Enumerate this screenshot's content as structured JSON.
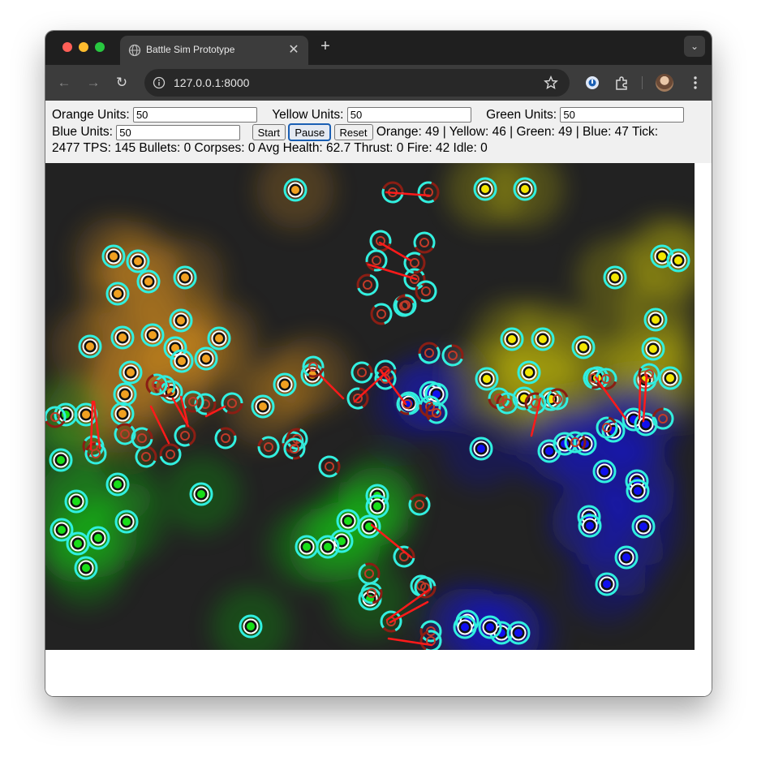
{
  "browser": {
    "tab_title": "Battle Sim Prototype",
    "url": "127.0.0.1:8000",
    "favicon": "globe-icon"
  },
  "controls": {
    "orange_label": "Orange Units:",
    "orange_value": "50",
    "yellow_label": "Yellow Units:",
    "yellow_value": "50",
    "green_label": "Green Units:",
    "green_value": "50",
    "blue_label": "Blue Units:",
    "blue_value": "50",
    "start_label": "Start",
    "pause_label": "Pause",
    "reset_label": "Reset"
  },
  "stats": {
    "line1": "Orange: 49 | Yellow: 46 | Green: 49 | Blue: 47 Tick:",
    "line2": "2477 TPS: 145 Bullets: 0 Corpses: 0 Avg Health: 62.7 Thrust: 0 Fire: 42 Idle: 0"
  },
  "colors": {
    "orange": "#f0a020",
    "yellow": "#f2e600",
    "green": "#18dd18",
    "blue": "#1010ee",
    "ring": "#30f0e0",
    "laser": "#ff1a1a",
    "canvas_bg": "#222222"
  },
  "simulation": {
    "units": {
      "orange": [
        [
          308,
          33
        ],
        [
          84,
          115
        ],
        [
          114,
          121
        ],
        [
          127,
          146
        ],
        [
          89,
          161
        ],
        [
          172,
          141
        ],
        [
          167,
          194
        ],
        [
          95,
          215
        ],
        [
          55,
          226
        ],
        [
          132,
          212
        ],
        [
          214,
          216
        ],
        [
          160,
          228
        ],
        [
          105,
          258
        ],
        [
          98,
          285
        ],
        [
          155,
          282
        ],
        [
          198,
          241
        ],
        [
          168,
          244
        ],
        [
          95,
          309
        ],
        [
          50,
          310
        ],
        [
          295,
          273
        ],
        [
          268,
          300
        ],
        [
          329,
          261
        ]
      ],
      "yellow": [
        [
          542,
          32
        ],
        [
          591,
          32
        ],
        [
          702,
          141
        ],
        [
          760,
          115
        ],
        [
          780,
          120
        ],
        [
          575,
          217
        ],
        [
          613,
          217
        ],
        [
          752,
          193
        ],
        [
          749,
          229
        ],
        [
          663,
          227
        ],
        [
          544,
          266
        ],
        [
          596,
          258
        ],
        [
          623,
          291
        ],
        [
          680,
          265
        ],
        [
          739,
          267
        ],
        [
          770,
          265
        ],
        [
          590,
          290
        ]
      ],
      "green": [
        [
          19,
          366
        ],
        [
          89,
          396
        ],
        [
          40,
          469
        ],
        [
          20,
          452
        ],
        [
          100,
          442
        ],
        [
          38,
          417
        ],
        [
          65,
          462
        ],
        [
          50,
          499
        ],
        [
          192,
          408
        ],
        [
          409,
          410
        ],
        [
          409,
          423
        ],
        [
          373,
          441
        ],
        [
          365,
          466
        ],
        [
          399,
          448
        ],
        [
          348,
          473
        ],
        [
          322,
          473
        ],
        [
          400,
          537
        ],
        [
          253,
          571
        ],
        [
          25,
          310
        ]
      ],
      "blue": [
        [
          448,
          296
        ],
        [
          475,
          283
        ],
        [
          482,
          285
        ],
        [
          537,
          352
        ],
        [
          621,
          355
        ],
        [
          640,
          346
        ],
        [
          665,
          346
        ],
        [
          689,
          380
        ],
        [
          729,
          392
        ],
        [
          730,
          404
        ],
        [
          670,
          436
        ],
        [
          671,
          447
        ],
        [
          737,
          448
        ],
        [
          716,
          486
        ],
        [
          692,
          519
        ],
        [
          520,
          565
        ],
        [
          517,
          572
        ],
        [
          562,
          579
        ],
        [
          583,
          579
        ],
        [
          548,
          572
        ],
        [
          725,
          316
        ],
        [
          740,
          322
        ],
        [
          700,
          330
        ]
      ]
    },
    "damaged_units": [
      [
        428,
        36
      ],
      [
        472,
        36
      ],
      [
        413,
        96
      ],
      [
        408,
        120
      ],
      [
        414,
        186
      ],
      [
        397,
        150
      ],
      [
        442,
        176
      ],
      [
        455,
        143
      ],
      [
        455,
        123
      ],
      [
        467,
        98
      ],
      [
        469,
        158
      ],
      [
        444,
        175
      ],
      [
        473,
        234
      ],
      [
        502,
        237
      ],
      [
        419,
        256
      ],
      [
        446,
        297
      ],
      [
        474,
        300
      ],
      [
        482,
        308
      ],
      [
        419,
        266
      ],
      [
        390,
        258
      ],
      [
        385,
        290
      ],
      [
        330,
        251
      ],
      [
        305,
        344
      ],
      [
        275,
        350
      ],
      [
        310,
        340
      ],
      [
        222,
        339
      ],
      [
        350,
        374
      ],
      [
        307,
        352
      ],
      [
        12,
        313
      ],
      [
        59,
        349
      ],
      [
        62,
        358
      ],
      [
        154,
        359
      ],
      [
        124,
        362
      ],
      [
        197,
        297
      ],
      [
        182,
        294
      ],
      [
        147,
        275
      ],
      [
        137,
        273
      ],
      [
        98,
        334
      ],
      [
        119,
        339
      ],
      [
        172,
        336
      ],
      [
        230,
        296
      ],
      [
        559,
        290
      ],
      [
        569,
        296
      ],
      [
        604,
        296
      ],
      [
        631,
        291
      ],
      [
        653,
        344
      ],
      [
        676,
        265
      ],
      [
        691,
        266
      ],
      [
        744,
        260
      ],
      [
        761,
        315
      ],
      [
        692,
        326
      ],
      [
        399,
        506
      ],
      [
        402,
        530
      ],
      [
        426,
        565
      ],
      [
        475,
        577
      ],
      [
        475,
        589
      ],
      [
        461,
        421
      ],
      [
        442,
        485
      ],
      [
        463,
        521
      ],
      [
        468,
        523
      ]
    ],
    "lasers": [
      [
        420,
        36
      ],
      [
        473,
        40
      ],
      [
        412,
        98
      ],
      [
        450,
        120
      ],
      [
        398,
        125
      ],
      [
        457,
        143
      ],
      [
        339,
        262
      ],
      [
        367,
        290
      ],
      [
        423,
        255
      ],
      [
        381,
        294
      ],
      [
        157,
        290
      ],
      [
        176,
        324
      ],
      [
        130,
        300
      ],
      [
        152,
        345
      ],
      [
        198,
        312
      ],
      [
        221,
        300
      ],
      [
        167,
        288
      ],
      [
        175,
        320
      ],
      [
        60,
        294
      ],
      [
        67,
        351
      ],
      [
        58,
        294
      ],
      [
        56,
        353
      ],
      [
        610,
        290
      ],
      [
        599,
        336
      ],
      [
        678,
        264
      ],
      [
        715,
        315
      ],
      [
        733,
        268
      ],
      [
        732,
        315
      ],
      [
        741,
        261
      ],
      [
        737,
        318
      ],
      [
        402,
        446
      ],
      [
        451,
        486
      ],
      [
        421,
        563
      ],
      [
        474,
        525
      ],
      [
        425,
        566
      ],
      [
        471,
        541
      ],
      [
        423,
        586
      ],
      [
        476,
        594
      ],
      [
        413,
        255
      ],
      [
        444,
        297
      ]
    ]
  }
}
